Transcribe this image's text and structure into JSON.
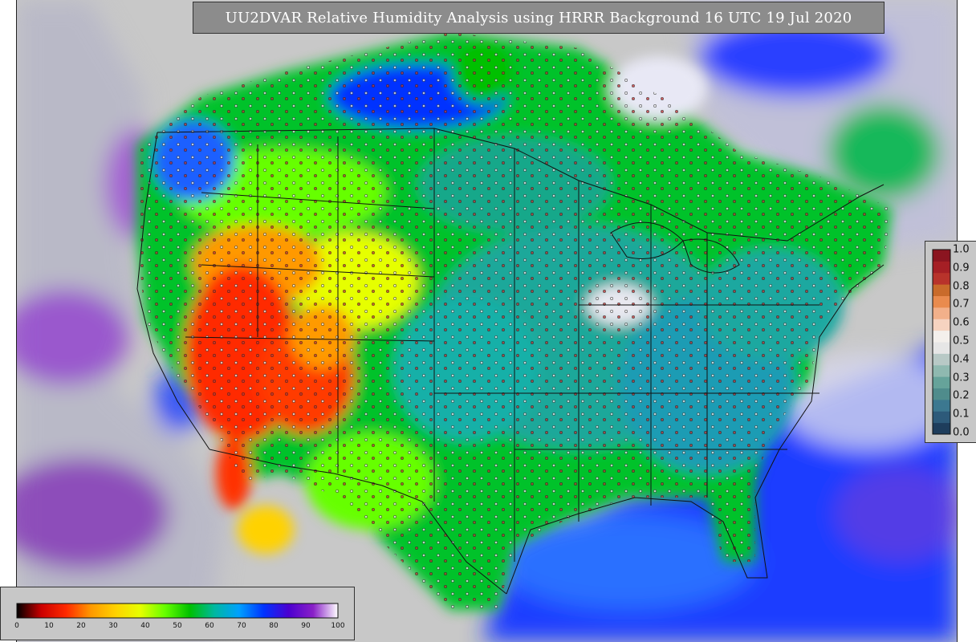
{
  "title": "UU2DVAR Relative Humidity Analysis using HRRR Background 16 UTC 19 Jul 2020",
  "rh_colorbar": {
    "ticks": [
      "0",
      "10",
      "20",
      "30",
      "40",
      "50",
      "60",
      "70",
      "80",
      "90",
      "100"
    ],
    "stops": [
      "#000000",
      "#cc0000",
      "#ff2a00",
      "#ff9900",
      "#ffd200",
      "#e6ff00",
      "#66ff00",
      "#00c000",
      "#00b8a0",
      "#00a0ff",
      "#0033ff",
      "#4b00d0",
      "#8a20c8",
      "#ffffff"
    ]
  },
  "fraction_colorbar": {
    "ticks": [
      "1.0",
      "0.9",
      "0.8",
      "0.7",
      "0.6",
      "0.5",
      "0.4",
      "0.3",
      "0.2",
      "0.1",
      "0.0"
    ],
    "bands": [
      "#1e3d5c",
      "#2d5a7a",
      "#3c7890",
      "#4f8c8c",
      "#66a39a",
      "#8fb9b0",
      "#b8c9c6",
      "#e6e6e6",
      "#f4f0ec",
      "#f6d3c0",
      "#f2b08a",
      "#e98b4e",
      "#c96b2b",
      "#b8332b",
      "#a51f25",
      "#8b1520"
    ]
  },
  "colors": {
    "ocean_purple": "#7a1fb5",
    "ocean_blue": "#1a3dff",
    "land_green": "#00c22a",
    "land_teal": "#1aa89a",
    "dry_red": "#ff1a00",
    "dry_orange": "#ff9a00",
    "background_gray": "#c8c8c8"
  }
}
